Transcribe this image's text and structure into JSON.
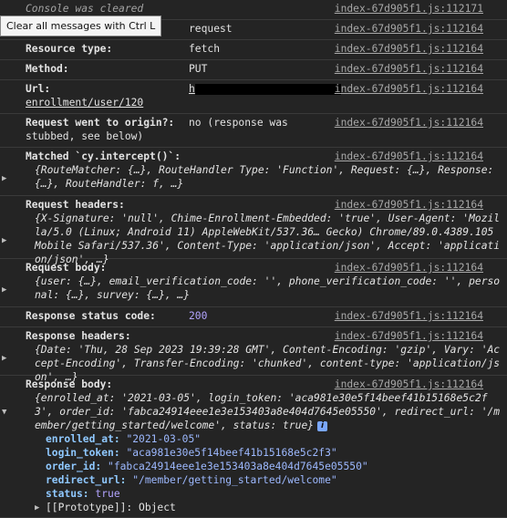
{
  "console_cleared": "Console was cleared",
  "cleared_src": "index-67d905f1.js:112171",
  "tooltip": "Clear all messages with Ctrl L",
  "src": "index-67d905f1.js:112164",
  "rows": {
    "alias_value": "request",
    "resource_type_label": "Resource type:",
    "resource_type_value": "fetch",
    "method_label": "Method:",
    "method_value": "PUT",
    "url_label": "Url:",
    "url_value_prefix": "h",
    "url_value_suffix": "enrollment/user/120",
    "origin_label": "Request went to origin?:",
    "origin_value_line1": "no (response was",
    "origin_value_line2": "stubbed, see below)",
    "matched_label": "Matched `cy.intercept()`:",
    "matched_line1": "{RouteMatcher: {…}, RouteHandler Type: 'Function', Request: {…}, Response:",
    "matched_line2": "{…}, RouteHandler: f, …}",
    "req_headers_label": "Request headers:",
    "req_headers_lines": [
      "{X-Signature: 'null', Chime-Enrollment-Embedded: 'true', User-Agent: 'Mozil",
      "la/5.0 (Linux; Android 11) AppleWebKit/537.36… Gecko) Chrome/89.0.4389.105",
      "Mobile Safari/537.36', Content-Type: 'application/json', Accept: 'applicati",
      "on/json', …}"
    ],
    "req_body_label": "Request body:",
    "req_body_lines": [
      "{user: {…}, email_verification_code: '', phone_verification_code: '', perso",
      "nal: {…}, survey: {…}, …}"
    ],
    "status_label": "Response status code:",
    "status_value": "200",
    "resp_headers_label": "Response headers:",
    "resp_headers_lines": [
      "{Date: 'Thu, 28 Sep 2023 19:39:28 GMT', Content-Encoding: 'gzip', Vary: 'Ac",
      "cept-Encoding', Transfer-Encoding: 'chunked', content-type: 'application/js",
      "on', …}"
    ],
    "resp_body_label": "Response body:",
    "resp_body_lines": [
      "{enrolled_at: '2021-03-05', login_token: 'aca981e30e5f14beef41b15168e5c2f",
      "3', order_id: 'fabca24914eee1e3e153403a8e404d7645e05550', redirect_url: '/m",
      "ember/getting_started/welcome', status: true}"
    ],
    "info_icon": "i",
    "props": [
      {
        "key": "enrolled_at:",
        "value": "\"2021-03-05\""
      },
      {
        "key": "login_token:",
        "value": "\"aca981e30e5f14beef41b15168e5c2f3\""
      },
      {
        "key": "order_id:",
        "value": "\"fabca24914eee1e3e153403a8e404d7645e05550\""
      },
      {
        "key": "redirect_url:",
        "value": "\"/member/getting_started/welcome\""
      },
      {
        "key": "status:",
        "value": "true"
      }
    ],
    "prototype": "[[Prototype]]: Object"
  }
}
